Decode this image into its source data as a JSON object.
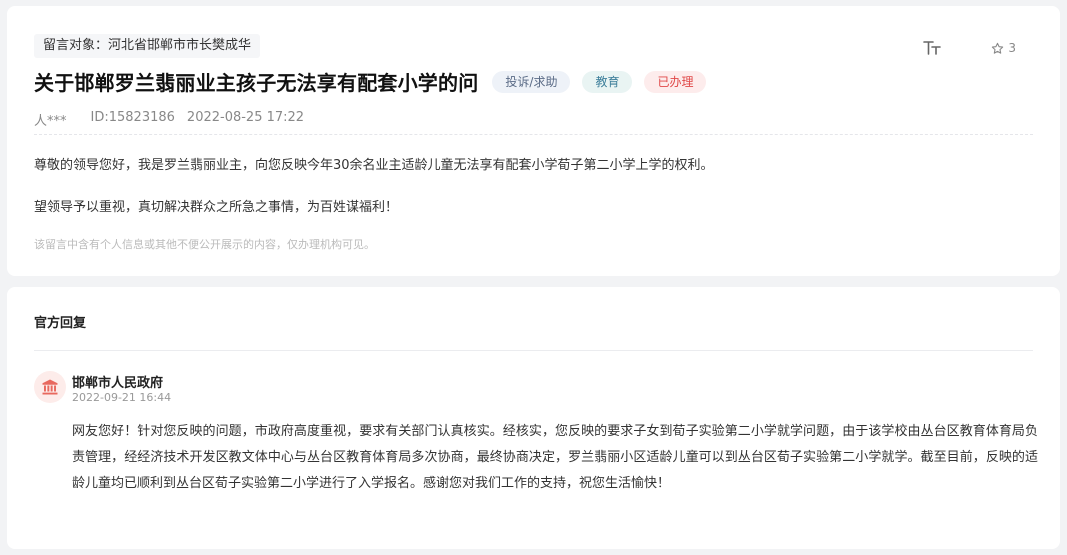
{
  "message": {
    "target_label": "留言对象：河北省邯郸市市长樊成华",
    "title": "关于邯郸罗兰翡丽业主孩子无法享有配套小学的问",
    "tags": {
      "type": "投诉/求助",
      "field": "教育",
      "status": "已办理"
    },
    "author": "人***",
    "id_text": "ID:15823186",
    "datetime": "2022-08-25 17:22",
    "star_count": "3",
    "paragraphs": [
      "尊敬的领导您好，我是罗兰翡丽业主，向您反映今年30余名业主适龄儿童无法享有配套小学荀子第二小学上学的权利。",
      "望领导予以重视，真切解决群众之所急之事情，为百姓谋福利！"
    ],
    "privacy_notice": "该留言中含有个人信息或其他不便公开展示的内容，仅办理机构可见。"
  },
  "reply": {
    "section_title": "官方回复",
    "org_name": "邯郸市人民政府",
    "date": "2022-09-21 16:44",
    "text": "网友您好！针对您反映的问题，市政府高度重视，要求有关部门认真核实。经核实，您反映的要求子女到荀子实验第二小学就学问题，由于该学校由丛台区教育体育局负责管理，经经济技术开发区教文体中心与丛台区教育体育局多次协商，最终协商决定，罗兰翡丽小区适龄儿童可以到丛台区荀子实验第二小学就学。截至目前，反映的适龄儿童均已顺利到丛台区荀子实验第二小学进行了入学报名。感谢您对我们工作的支持，祝您生活愉快！"
  },
  "icons": {
    "font_size": "font-size-icon",
    "star": "star-outline-icon",
    "avatar": "government-building-icon"
  },
  "colors": {
    "status_red": "#e04848",
    "field_teal": "#3c7e9a",
    "type_slate": "#5a6b86",
    "avatar_red": "#e8685e"
  }
}
